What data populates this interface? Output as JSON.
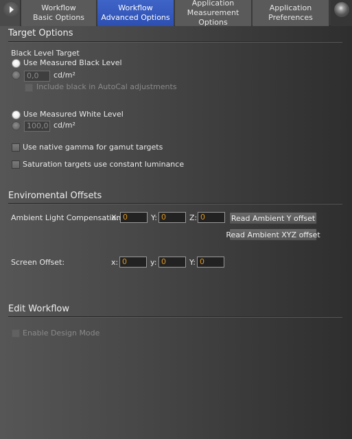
{
  "tabs": [
    {
      "line1": "Workflow",
      "line2": "Basic Options",
      "active": false
    },
    {
      "line1": "Workflow",
      "line2": "Advanced Options",
      "active": true
    },
    {
      "line1": "Application",
      "line2": "Measurement Options",
      "active": false
    },
    {
      "line1": "Application",
      "line2": "Preferences",
      "active": false
    }
  ],
  "icons": {
    "nav": "play-arrow-icon",
    "pin": "pushpin-icon"
  },
  "target_options": {
    "title": "Target Options",
    "black_level": {
      "label": "Black Level Target",
      "use_measured_label": "Use Measured Black Level",
      "use_measured_selected": true,
      "custom_value": "0,0",
      "unit": "cd/m²",
      "include_black_label": "Include black in AutoCal adjustments",
      "include_black_checked": false,
      "include_black_enabled": false
    },
    "white_level": {
      "use_measured_label": "Use Measured White Level",
      "use_measured_selected": true,
      "custom_value": "100,0",
      "unit": "cd/m²"
    },
    "native_gamma_label": "Use native gamma for gamut targets",
    "native_gamma_checked": false,
    "saturation_label": "Saturation targets use constant luminance",
    "saturation_checked": false
  },
  "environmental_offsets": {
    "title": "Enviromental Offsets",
    "ambient": {
      "label": "Ambient Light Compensation",
      "x_label": "X:",
      "x_value": "0",
      "y_label": "Y:",
      "y_value": "0",
      "z_label": "Z:",
      "z_value": "0",
      "read_y_button": "Read Ambient Y offset",
      "read_xyz_button": "Read Ambient XYZ offset"
    },
    "screen": {
      "label": "Screen Offset:",
      "x_label": "x:",
      "x_value": "0",
      "y_label": "y:",
      "y_value": "0",
      "Y_label": "Y:",
      "Y_value": "0"
    }
  },
  "edit_workflow": {
    "title": "Edit Workflow",
    "design_mode_label": "Enable Design Mode",
    "design_mode_checked": false,
    "design_mode_enabled": false
  },
  "colors": {
    "active_tab": "#3f64c8",
    "input_value": "#e29a1a"
  }
}
